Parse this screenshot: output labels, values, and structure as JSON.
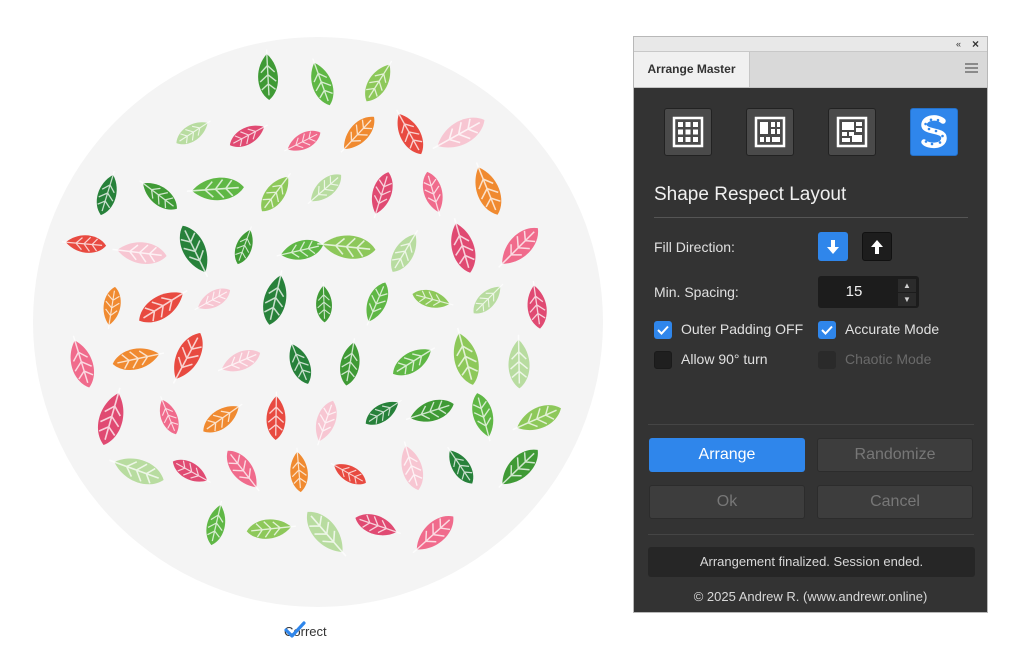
{
  "artwork": {
    "circle_color": "#f4f4f4",
    "leaf_colors": [
      "#3f9a35",
      "#5fb745",
      "#8dc85a",
      "#b8dca0",
      "#e04a72",
      "#f06b8c",
      "#f08a30",
      "#e84a40",
      "#f7c6d2",
      "#27813a"
    ],
    "caption": "Correct"
  },
  "panel": {
    "tab_title": "Arrange Master",
    "collapse_glyph": "«",
    "close_glyph": "×",
    "mode_icons": [
      "grid-icon",
      "grid-tall-icon",
      "grid-wide-icon",
      "shape-respect-icon"
    ],
    "active_mode": "shape-respect-icon",
    "section_title": "Shape Respect Layout",
    "fill_direction_label": "Fill Direction:",
    "min_spacing_label": "Min. Spacing:",
    "min_spacing_value": "15",
    "checkboxes": {
      "outer_padding": {
        "label": "Outer Padding OFF",
        "checked": true
      },
      "accurate_mode": {
        "label": "Accurate Mode",
        "checked": true
      },
      "allow_turn": {
        "label": "Allow 90° turn",
        "checked": false
      },
      "chaotic_mode": {
        "label": "Chaotic Mode",
        "checked": false,
        "disabled": true
      }
    },
    "buttons": {
      "arrange": "Arrange",
      "randomize": "Randomize",
      "ok": "Ok",
      "cancel": "Cancel"
    },
    "status": "Arrangement finalized. Session ended.",
    "copyright": "© 2025 Andrew R. (www.andrewr.online)",
    "accent_color": "#2f86eb"
  }
}
